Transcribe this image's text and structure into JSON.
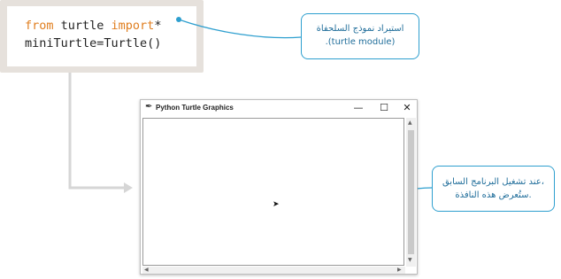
{
  "code": {
    "line1": {
      "kw1": "from",
      "mod": " turtle ",
      "kw2": "import",
      "star": "*"
    },
    "line2": "miniTurtle=Turtle()"
  },
  "callouts": {
    "import": {
      "line1": "استيراد نموذج السلحفاة",
      "line2": ".(turtle module)"
    },
    "run": {
      "line1": "عند تشغيل البرنامج السابق،",
      "line2": "ستُعرض هذه النافذة."
    }
  },
  "window": {
    "title": "Python Turtle Graphics",
    "minimize_icon": "minimize-icon",
    "maximize_icon": "maximize-icon",
    "close_icon": "close-icon"
  },
  "colors": {
    "keyword": "#e07e1f",
    "accent": "#2e9fcf",
    "panel": "#e6e1dc"
  }
}
